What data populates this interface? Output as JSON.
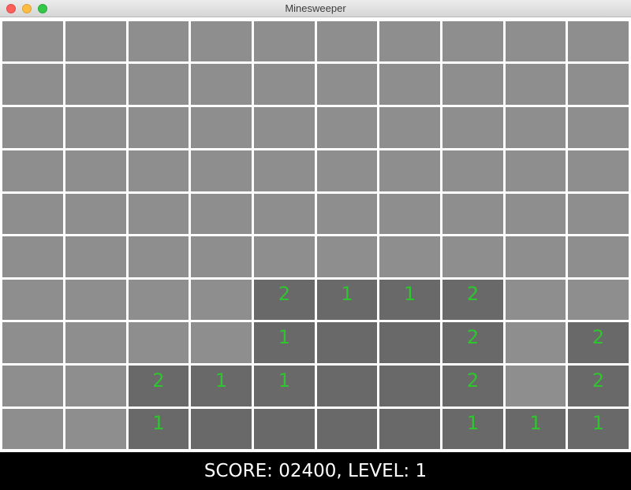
{
  "window": {
    "title": "Minesweeper",
    "buttons": [
      "close",
      "minimize",
      "zoom"
    ]
  },
  "colors": {
    "hidden_cell": "#8e8e8e",
    "revealed_cell": "#696969",
    "number": "#2ec52e",
    "status_bg": "#000000",
    "status_text": "#ffffff"
  },
  "board": {
    "rows": 10,
    "cols": 10,
    "cells": [
      [
        "h",
        "h",
        "h",
        "h",
        "h",
        "h",
        "h",
        "h",
        "h",
        "h"
      ],
      [
        "h",
        "h",
        "h",
        "h",
        "h",
        "h",
        "h",
        "h",
        "h",
        "h"
      ],
      [
        "h",
        "h",
        "h",
        "h",
        "h",
        "h",
        "h",
        "h",
        "h",
        "h"
      ],
      [
        "h",
        "h",
        "h",
        "h",
        "h",
        "h",
        "h",
        "h",
        "h",
        "h"
      ],
      [
        "h",
        "h",
        "h",
        "h",
        "h",
        "h",
        "h",
        "h",
        "h",
        "h"
      ],
      [
        "h",
        "h",
        "h",
        "h",
        "h",
        "h",
        "h",
        "h",
        "h",
        "h"
      ],
      [
        "h",
        "h",
        "h",
        "h",
        "2",
        "1",
        "1",
        "2",
        "h",
        "h"
      ],
      [
        "h",
        "h",
        "h",
        "h",
        "1",
        "0",
        "0",
        "2",
        "h",
        "2"
      ],
      [
        "h",
        "h",
        "2",
        "1",
        "1",
        "0",
        "0",
        "2",
        "h",
        "2"
      ],
      [
        "h",
        "h",
        "1",
        "0",
        "0",
        "0",
        "0",
        "1",
        "1",
        "1"
      ]
    ]
  },
  "status": {
    "text": "SCORE: 02400, LEVEL: 1"
  }
}
